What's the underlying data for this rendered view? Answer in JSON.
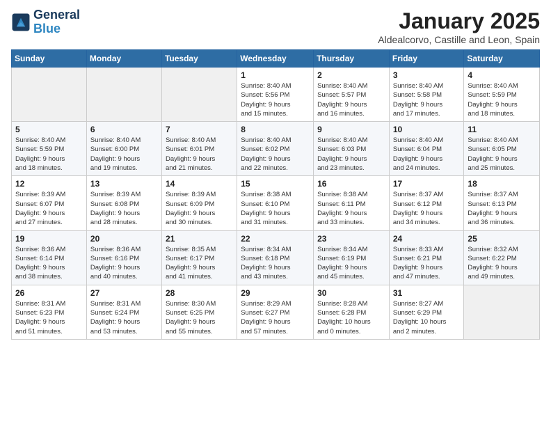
{
  "logo": {
    "line1": "General",
    "line2": "Blue"
  },
  "title": "January 2025",
  "subtitle": "Aldealcorvo, Castille and Leon, Spain",
  "days_header": [
    "Sunday",
    "Monday",
    "Tuesday",
    "Wednesday",
    "Thursday",
    "Friday",
    "Saturday"
  ],
  "weeks": [
    [
      {
        "day": "",
        "info": ""
      },
      {
        "day": "",
        "info": ""
      },
      {
        "day": "",
        "info": ""
      },
      {
        "day": "1",
        "info": "Sunrise: 8:40 AM\nSunset: 5:56 PM\nDaylight: 9 hours\nand 15 minutes."
      },
      {
        "day": "2",
        "info": "Sunrise: 8:40 AM\nSunset: 5:57 PM\nDaylight: 9 hours\nand 16 minutes."
      },
      {
        "day": "3",
        "info": "Sunrise: 8:40 AM\nSunset: 5:58 PM\nDaylight: 9 hours\nand 17 minutes."
      },
      {
        "day": "4",
        "info": "Sunrise: 8:40 AM\nSunset: 5:59 PM\nDaylight: 9 hours\nand 18 minutes."
      }
    ],
    [
      {
        "day": "5",
        "info": "Sunrise: 8:40 AM\nSunset: 5:59 PM\nDaylight: 9 hours\nand 18 minutes."
      },
      {
        "day": "6",
        "info": "Sunrise: 8:40 AM\nSunset: 6:00 PM\nDaylight: 9 hours\nand 19 minutes."
      },
      {
        "day": "7",
        "info": "Sunrise: 8:40 AM\nSunset: 6:01 PM\nDaylight: 9 hours\nand 21 minutes."
      },
      {
        "day": "8",
        "info": "Sunrise: 8:40 AM\nSunset: 6:02 PM\nDaylight: 9 hours\nand 22 minutes."
      },
      {
        "day": "9",
        "info": "Sunrise: 8:40 AM\nSunset: 6:03 PM\nDaylight: 9 hours\nand 23 minutes."
      },
      {
        "day": "10",
        "info": "Sunrise: 8:40 AM\nSunset: 6:04 PM\nDaylight: 9 hours\nand 24 minutes."
      },
      {
        "day": "11",
        "info": "Sunrise: 8:40 AM\nSunset: 6:05 PM\nDaylight: 9 hours\nand 25 minutes."
      }
    ],
    [
      {
        "day": "12",
        "info": "Sunrise: 8:39 AM\nSunset: 6:07 PM\nDaylight: 9 hours\nand 27 minutes."
      },
      {
        "day": "13",
        "info": "Sunrise: 8:39 AM\nSunset: 6:08 PM\nDaylight: 9 hours\nand 28 minutes."
      },
      {
        "day": "14",
        "info": "Sunrise: 8:39 AM\nSunset: 6:09 PM\nDaylight: 9 hours\nand 30 minutes."
      },
      {
        "day": "15",
        "info": "Sunrise: 8:38 AM\nSunset: 6:10 PM\nDaylight: 9 hours\nand 31 minutes."
      },
      {
        "day": "16",
        "info": "Sunrise: 8:38 AM\nSunset: 6:11 PM\nDaylight: 9 hours\nand 33 minutes."
      },
      {
        "day": "17",
        "info": "Sunrise: 8:37 AM\nSunset: 6:12 PM\nDaylight: 9 hours\nand 34 minutes."
      },
      {
        "day": "18",
        "info": "Sunrise: 8:37 AM\nSunset: 6:13 PM\nDaylight: 9 hours\nand 36 minutes."
      }
    ],
    [
      {
        "day": "19",
        "info": "Sunrise: 8:36 AM\nSunset: 6:14 PM\nDaylight: 9 hours\nand 38 minutes."
      },
      {
        "day": "20",
        "info": "Sunrise: 8:36 AM\nSunset: 6:16 PM\nDaylight: 9 hours\nand 40 minutes."
      },
      {
        "day": "21",
        "info": "Sunrise: 8:35 AM\nSunset: 6:17 PM\nDaylight: 9 hours\nand 41 minutes."
      },
      {
        "day": "22",
        "info": "Sunrise: 8:34 AM\nSunset: 6:18 PM\nDaylight: 9 hours\nand 43 minutes."
      },
      {
        "day": "23",
        "info": "Sunrise: 8:34 AM\nSunset: 6:19 PM\nDaylight: 9 hours\nand 45 minutes."
      },
      {
        "day": "24",
        "info": "Sunrise: 8:33 AM\nSunset: 6:21 PM\nDaylight: 9 hours\nand 47 minutes."
      },
      {
        "day": "25",
        "info": "Sunrise: 8:32 AM\nSunset: 6:22 PM\nDaylight: 9 hours\nand 49 minutes."
      }
    ],
    [
      {
        "day": "26",
        "info": "Sunrise: 8:31 AM\nSunset: 6:23 PM\nDaylight: 9 hours\nand 51 minutes."
      },
      {
        "day": "27",
        "info": "Sunrise: 8:31 AM\nSunset: 6:24 PM\nDaylight: 9 hours\nand 53 minutes."
      },
      {
        "day": "28",
        "info": "Sunrise: 8:30 AM\nSunset: 6:25 PM\nDaylight: 9 hours\nand 55 minutes."
      },
      {
        "day": "29",
        "info": "Sunrise: 8:29 AM\nSunset: 6:27 PM\nDaylight: 9 hours\nand 57 minutes."
      },
      {
        "day": "30",
        "info": "Sunrise: 8:28 AM\nSunset: 6:28 PM\nDaylight: 10 hours\nand 0 minutes."
      },
      {
        "day": "31",
        "info": "Sunrise: 8:27 AM\nSunset: 6:29 PM\nDaylight: 10 hours\nand 2 minutes."
      },
      {
        "day": "",
        "info": ""
      }
    ]
  ]
}
